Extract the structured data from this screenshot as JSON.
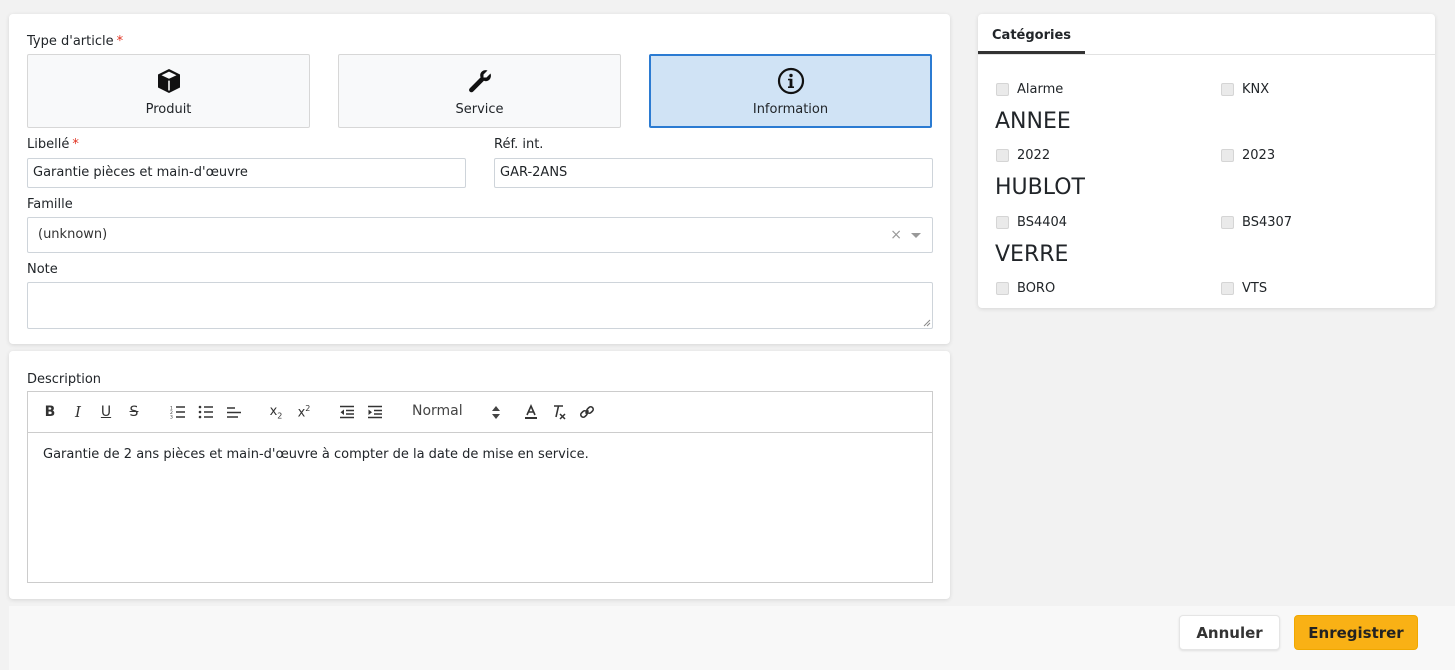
{
  "form": {
    "type_label": "Type d'article",
    "required_mark": "*",
    "types": [
      {
        "label": "Produit",
        "icon": "box-icon",
        "selected": false
      },
      {
        "label": "Service",
        "icon": "wrench-icon",
        "selected": false
      },
      {
        "label": "Information",
        "icon": "info-circle-icon",
        "selected": true
      }
    ],
    "libelle_label": "Libellé",
    "libelle_value": "Garantie pièces et main-d'œuvre",
    "ref_label": "Réf. int.",
    "ref_value": "GAR-2ANS",
    "famille_label": "Famille",
    "famille_value": "(unknown)",
    "note_label": "Note",
    "note_value": ""
  },
  "description": {
    "label": "Description",
    "format_select": "Normal",
    "content": "Garantie de 2 ans pièces et main-d'œuvre à compter de la date de mise en service."
  },
  "categories": {
    "tab_label": "Catégories",
    "ungrouped": [
      "Alarme",
      "KNX"
    ],
    "groups": [
      {
        "name": "ANNEE",
        "items": [
          "2022",
          "2023"
        ]
      },
      {
        "name": "HUBLOT",
        "items": [
          "BS4404",
          "BS4307"
        ]
      },
      {
        "name": "VERRE",
        "items": [
          "BORO",
          "VTS"
        ]
      }
    ]
  },
  "actions": {
    "cancel_label": "Annuler",
    "save_label": "Enregistrer"
  },
  "colors": {
    "accent": "#f9b115",
    "selected_bg": "#d0e3f5",
    "selected_border": "#2b7bd2",
    "required": "#e0301e"
  }
}
